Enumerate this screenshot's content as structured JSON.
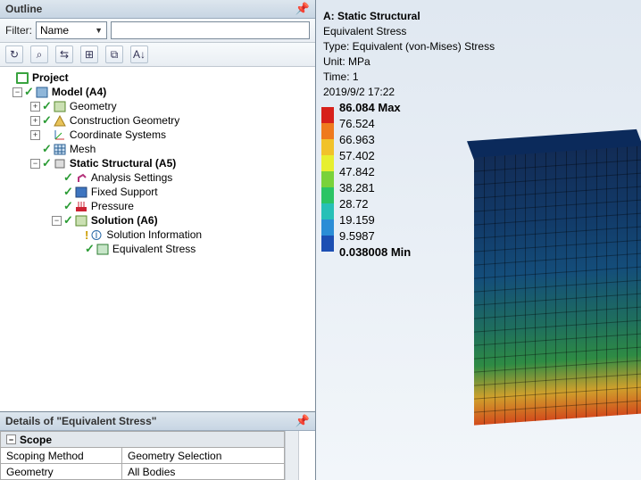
{
  "outline_title": "Outline",
  "filter": {
    "label": "Filter:",
    "selected": "Name",
    "input_value": ""
  },
  "toolbar_icons": [
    "refresh-icon",
    "filter-icon",
    "transfer-icon",
    "expand-icon",
    "copy-icon",
    "sort-icon"
  ],
  "tree": {
    "project": "Project",
    "model": "Model (A4)",
    "children": [
      {
        "id": "geometry",
        "label": "Geometry",
        "expandable": true
      },
      {
        "id": "constr_geom",
        "label": "Construction Geometry",
        "expandable": true
      },
      {
        "id": "coord_sys",
        "label": "Coordinate Systems",
        "expandable": true
      },
      {
        "id": "mesh",
        "label": "Mesh",
        "expandable": false
      }
    ],
    "static_structural": "Static Structural (A5)",
    "ss_children": [
      {
        "id": "analysis_settings",
        "label": "Analysis Settings"
      },
      {
        "id": "fixed_support",
        "label": "Fixed Support"
      },
      {
        "id": "pressure",
        "label": "Pressure"
      }
    ],
    "solution": "Solution (A6)",
    "sol_children": [
      {
        "id": "solution_info",
        "label": "Solution Information",
        "warn": true
      },
      {
        "id": "equiv_stress_node",
        "label": "Equivalent Stress",
        "warn": false
      }
    ]
  },
  "details_title": "Details of \"Equivalent Stress\"",
  "details_group": "Scope",
  "details_rows": [
    {
      "label": "Scoping Method",
      "value": "Geometry Selection"
    },
    {
      "label": "Geometry",
      "value": "All Bodies"
    }
  ],
  "result": {
    "title": "A: Static Structural",
    "line2": "Equivalent Stress",
    "line3": "Type: Equivalent (von-Mises) Stress",
    "unit": "Unit: MPa",
    "time": "Time: 1",
    "timestamp": "2019/9/2 17:22"
  },
  "legend": [
    {
      "color": "#d7201a",
      "label": "86.084 Max",
      "bold": true
    },
    {
      "color": "#ef7a1d",
      "label": "76.524"
    },
    {
      "color": "#f1c22a",
      "label": "66.963"
    },
    {
      "color": "#e7ef2f",
      "label": "57.402"
    },
    {
      "color": "#79d23a",
      "label": "47.842"
    },
    {
      "color": "#2bc465",
      "label": "38.281"
    },
    {
      "color": "#27c0b7",
      "label": "28.72"
    },
    {
      "color": "#2b8dd6",
      "label": "19.159"
    },
    {
      "color": "#1c4fb3",
      "label": "9.5987"
    },
    {
      "color": "",
      "label": "0.038008 Min",
      "bold": true
    }
  ],
  "chart_data": {
    "type": "colorbar",
    "title": "Equivalent (von-Mises) Stress",
    "unit": "MPa",
    "min": 0.038008,
    "max": 86.084,
    "ticks": [
      86.084,
      76.524,
      66.963,
      57.402,
      47.842,
      38.281,
      28.72,
      19.159,
      9.5987,
      0.038008
    ],
    "colors": [
      "#d7201a",
      "#ef7a1d",
      "#f1c22a",
      "#e7ef2f",
      "#79d23a",
      "#2bc465",
      "#27c0b7",
      "#2b8dd6",
      "#1c4fb3"
    ]
  }
}
